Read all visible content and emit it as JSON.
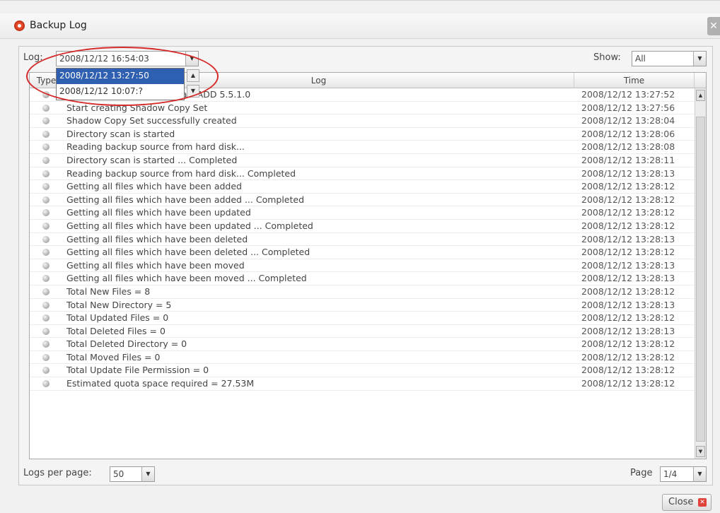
{
  "window": {
    "title": "Backup Log",
    "close_glyph": "✕"
  },
  "toolbar": {
    "log_label": "Log:",
    "log_value": "2008/12/12 16:54:03",
    "show_label": "Show:",
    "show_value": "All"
  },
  "dropdown": {
    "items": [
      {
        "label": "2008/12/12 13:27:50",
        "selected": true
      },
      {
        "label": "2008/12/12 10:07:?",
        "selected": false
      }
    ]
  },
  "grid": {
    "headers": {
      "type": "Type",
      "log": "Log",
      "time": "Time"
    },
    "rows": [
      {
        "msg": "Start: backup job...: CMeBaseADD 5.5.1.0",
        "time": "2008/12/12 13:27:52"
      },
      {
        "msg": "Start creating Shadow Copy Set",
        "time": "2008/12/12 13:27:56"
      },
      {
        "msg": "Shadow Copy Set successfully created",
        "time": "2008/12/12 13:28:04"
      },
      {
        "msg": "Directory scan is started",
        "time": "2008/12/12 13:28:06"
      },
      {
        "msg": "Reading backup source from hard disk...",
        "time": "2008/12/12 13:28:08"
      },
      {
        "msg": "Directory scan is started ... Completed",
        "time": "2008/12/12 13:28:11"
      },
      {
        "msg": "Reading backup source from hard disk... Completed",
        "time": "2008/12/12 13:28:13"
      },
      {
        "msg": "Getting all files which have been added",
        "time": "2008/12/12 13:28:12"
      },
      {
        "msg": "Getting all files which have been added ... Completed",
        "time": "2008/12/12 13:28:12"
      },
      {
        "msg": "Getting all files which have been updated",
        "time": "2008/12/12 13:28:12"
      },
      {
        "msg": "Getting all files which have been updated ... Completed",
        "time": "2008/12/12 13:28:12"
      },
      {
        "msg": "Getting all files which have been deleted",
        "time": "2008/12/12 13:28:13"
      },
      {
        "msg": "Getting all files which have been deleted ... Completed",
        "time": "2008/12/12 13:28:12"
      },
      {
        "msg": "Getting all files which have been moved",
        "time": "2008/12/12 13:28:13"
      },
      {
        "msg": "Getting all files which have been moved ... Completed",
        "time": "2008/12/12 13:28:13"
      },
      {
        "msg": "Total New Files = 8",
        "time": "2008/12/12 13:28:12"
      },
      {
        "msg": "Total New Directory = 5",
        "time": "2008/12/12 13:28:13"
      },
      {
        "msg": "Total Updated Files = 0",
        "time": "2008/12/12 13:28:12"
      },
      {
        "msg": "Total Deleted Files = 0",
        "time": "2008/12/12 13:28:13"
      },
      {
        "msg": "Total Deleted Directory = 0",
        "time": "2008/12/12 13:28:12"
      },
      {
        "msg": "Total Moved Files = 0",
        "time": "2008/12/12 13:28:12"
      },
      {
        "msg": "Total Update File Permission = 0",
        "time": "2008/12/12 13:28:12"
      },
      {
        "msg": "Estimated quota space required = 27.53M",
        "time": "2008/12/12 13:28:12"
      }
    ]
  },
  "footer": {
    "per_page_label": "Logs per page:",
    "per_page_value": "50",
    "page_label": "Page",
    "page_value": "1/4"
  },
  "close_button": {
    "label": "Close",
    "icon": "✕"
  },
  "colors": {
    "accent": "#2f5fb0",
    "highlight_ring": "#d42a2a",
    "close_red": "#e0423a"
  }
}
